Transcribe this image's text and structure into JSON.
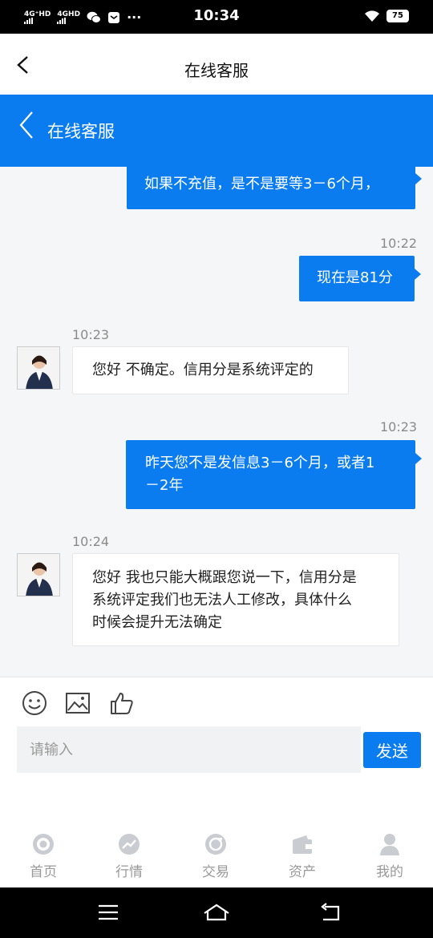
{
  "status_bar": {
    "time": "10:34",
    "net1": "4G⁺HD",
    "net2": "4GHD",
    "dots": "···",
    "battery": "75"
  },
  "top_nav": {
    "title": "在线客服"
  },
  "header": {
    "title": "在线客服"
  },
  "messages": [
    {
      "text": "如果不充值，是不是要等3－6个月，",
      "timestamp": ""
    },
    {
      "text": "现在是81分",
      "timestamp": "10:22"
    },
    {
      "text": "您好 不确定。信用分是系统评定的",
      "timestamp": "10:23"
    },
    {
      "text_lines": [
        "昨天您不是发信息3－6个月，或者1",
        "－2年"
      ],
      "timestamp": "10:23"
    },
    {
      "text_lines": [
        "您好 我也只能大概跟您说一下，信用分是",
        "系统评定我们也无法人工修改，具体什么",
        "时候会提升无法确定"
      ],
      "timestamp": "10:24"
    }
  ],
  "composer": {
    "placeholder": "请输入",
    "value": "",
    "send_label": "发送"
  },
  "tab_bar": {
    "items": [
      {
        "label": "首页",
        "icon": "home-icon"
      },
      {
        "label": "行情",
        "icon": "market-icon"
      },
      {
        "label": "交易",
        "icon": "trade-icon"
      },
      {
        "label": "资产",
        "icon": "wallet-icon"
      },
      {
        "label": "我的",
        "icon": "user-icon"
      }
    ]
  },
  "colors": {
    "accent": "#0a7cf0",
    "background": "#f5f6f8",
    "tab_inactive": "#999999"
  }
}
